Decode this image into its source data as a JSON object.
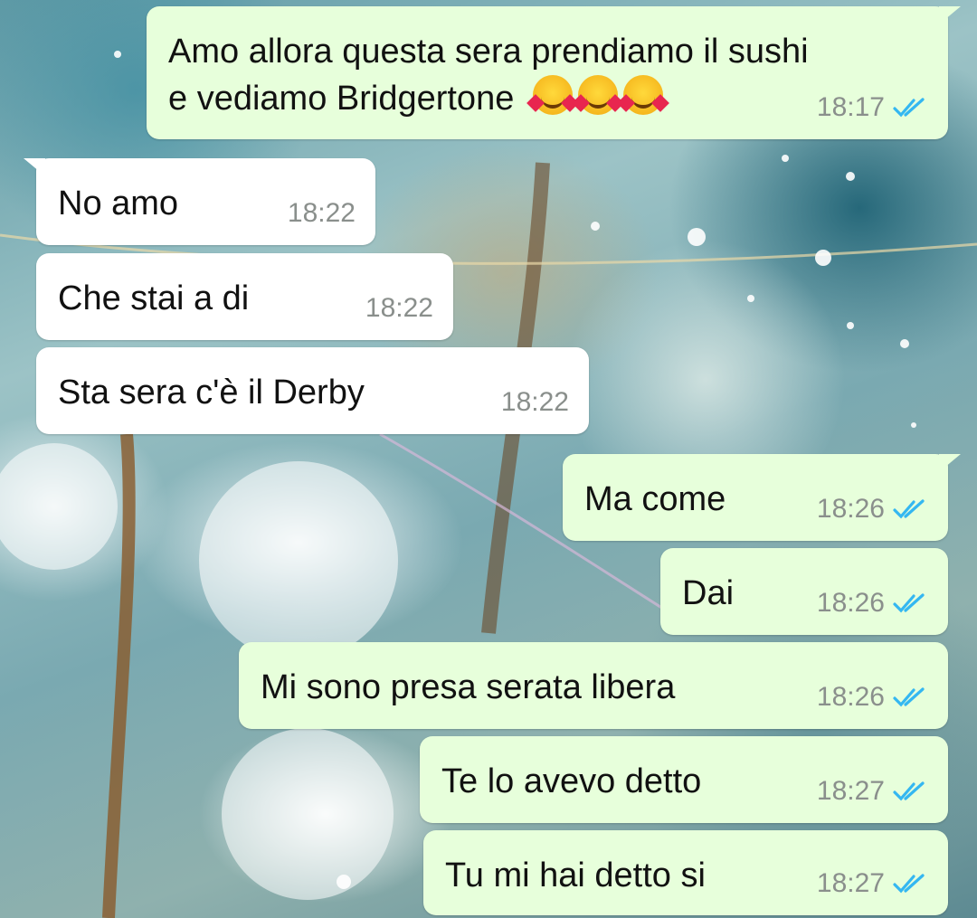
{
  "theme": {
    "outgoing_bubble": "#e7ffdb",
    "incoming_bubble": "#ffffff",
    "read_ticks": "#34b7f1"
  },
  "messages": [
    {
      "dir": "out",
      "line1": "Amo allora questa sera prendiamo il sushi",
      "line2": "e vediamo Bridgertone",
      "emoji": "smiling-face-with-hearts x3",
      "time": "18:17",
      "status": "read"
    },
    {
      "dir": "in",
      "text": "No amo",
      "time": "18:22"
    },
    {
      "dir": "in",
      "text": "Che stai a di",
      "time": "18:22"
    },
    {
      "dir": "in",
      "text": "Sta sera c'è il Derby",
      "time": "18:22"
    },
    {
      "dir": "out",
      "text": "Ma come",
      "time": "18:26",
      "status": "read"
    },
    {
      "dir": "out",
      "text": "Dai",
      "time": "18:26",
      "status": "read"
    },
    {
      "dir": "out",
      "text": "Mi sono presa serata libera",
      "time": "18:26",
      "status": "read"
    },
    {
      "dir": "out",
      "text": "Te lo avevo detto",
      "time": "18:27",
      "status": "read"
    },
    {
      "dir": "out",
      "text": "Tu mi hai detto si",
      "time": "18:27",
      "status": "read"
    }
  ]
}
